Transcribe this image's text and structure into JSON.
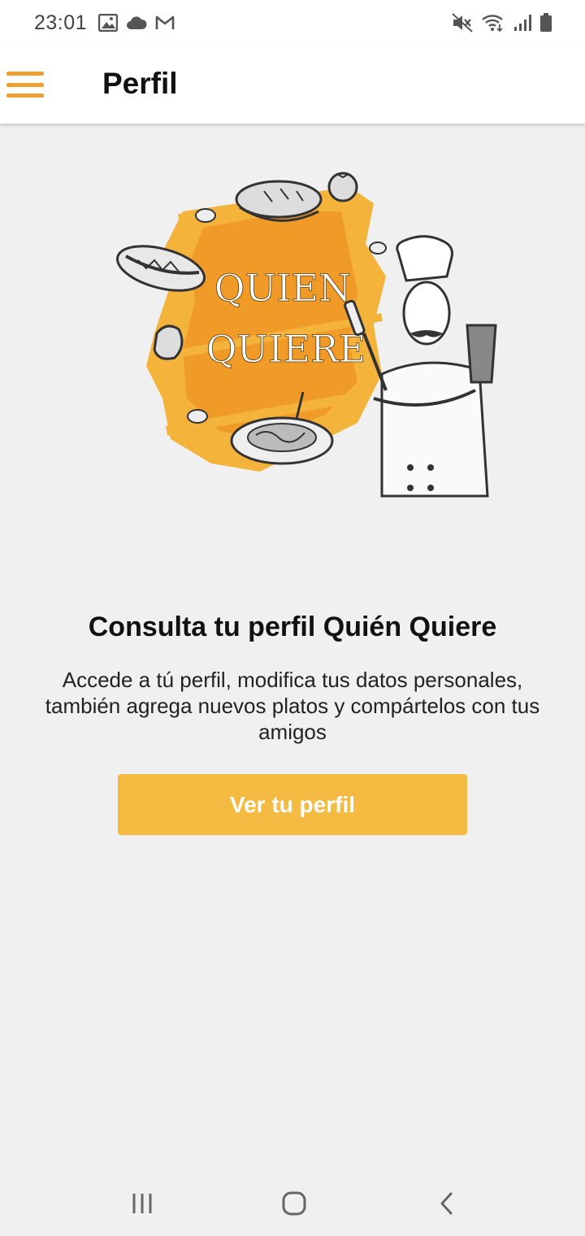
{
  "status_bar": {
    "time": "23:01",
    "icons_left": [
      "image-icon",
      "cloud-icon",
      "gmail-icon"
    ],
    "icons_right": [
      "mute-icon",
      "wifi-icon",
      "signal-icon",
      "battery-icon"
    ]
  },
  "app_bar": {
    "menu_icon": "hamburger-menu-icon",
    "title": "Perfil",
    "accent_color": "#f0a030"
  },
  "illustration": {
    "logo_line1": "QUIEN",
    "logo_line2": "QUIERE",
    "splash_color": "#f4a530"
  },
  "content": {
    "title": "Consulta tu perfil Quién Quiere",
    "description": "Accede a tú perfil, modifica tus datos personales, también agrega nuevos platos y compártelos con tus amigos",
    "button_label": "Ver tu perfil",
    "button_color": "#f4ba42"
  },
  "nav_bar": {
    "buttons": [
      "recent-apps-icon",
      "home-icon",
      "back-icon"
    ]
  }
}
